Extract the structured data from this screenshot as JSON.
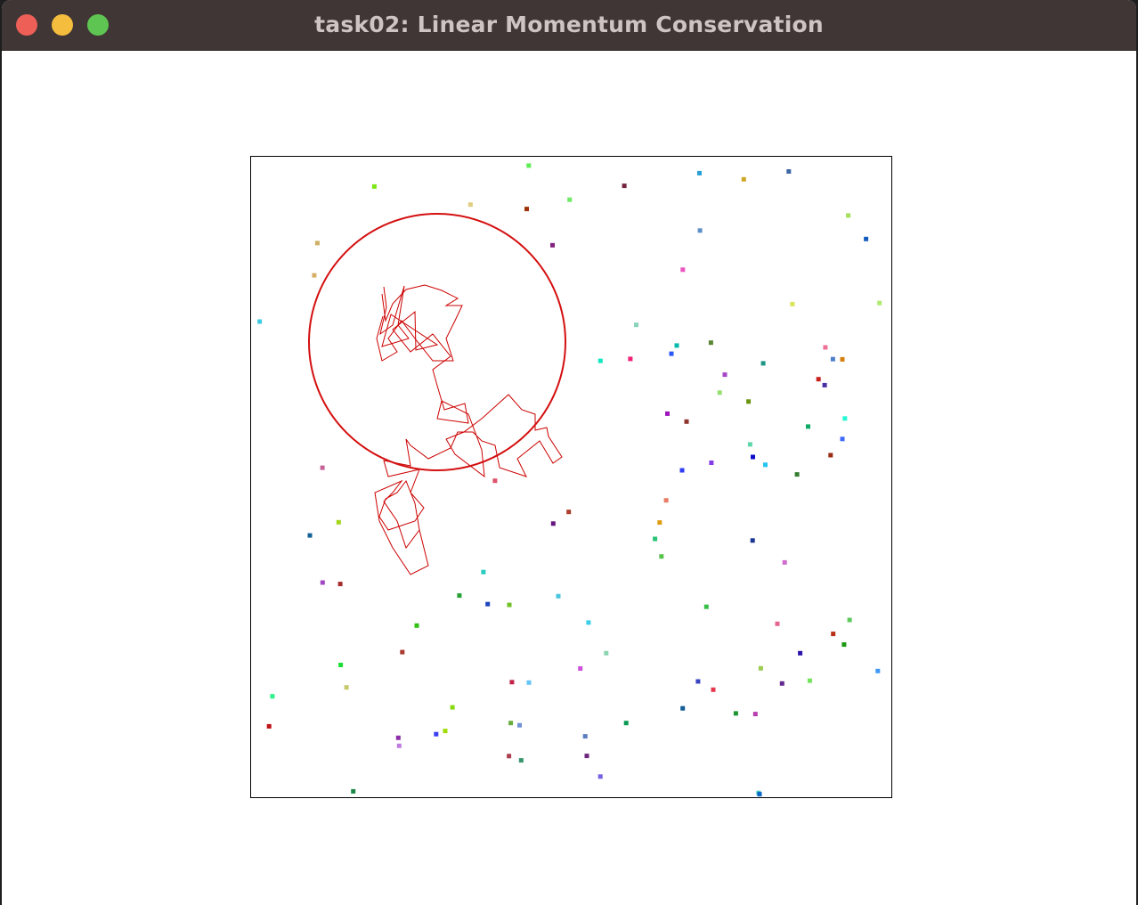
{
  "window": {
    "title": "task02: Linear Momentum Conservation",
    "controls": [
      "close",
      "minimize",
      "maximize"
    ]
  },
  "simulation": {
    "particle_count": 107,
    "large_disk": {
      "color": "#d40f0f",
      "trail_color": "#cc0000"
    },
    "frame_color": "#000000"
  }
}
